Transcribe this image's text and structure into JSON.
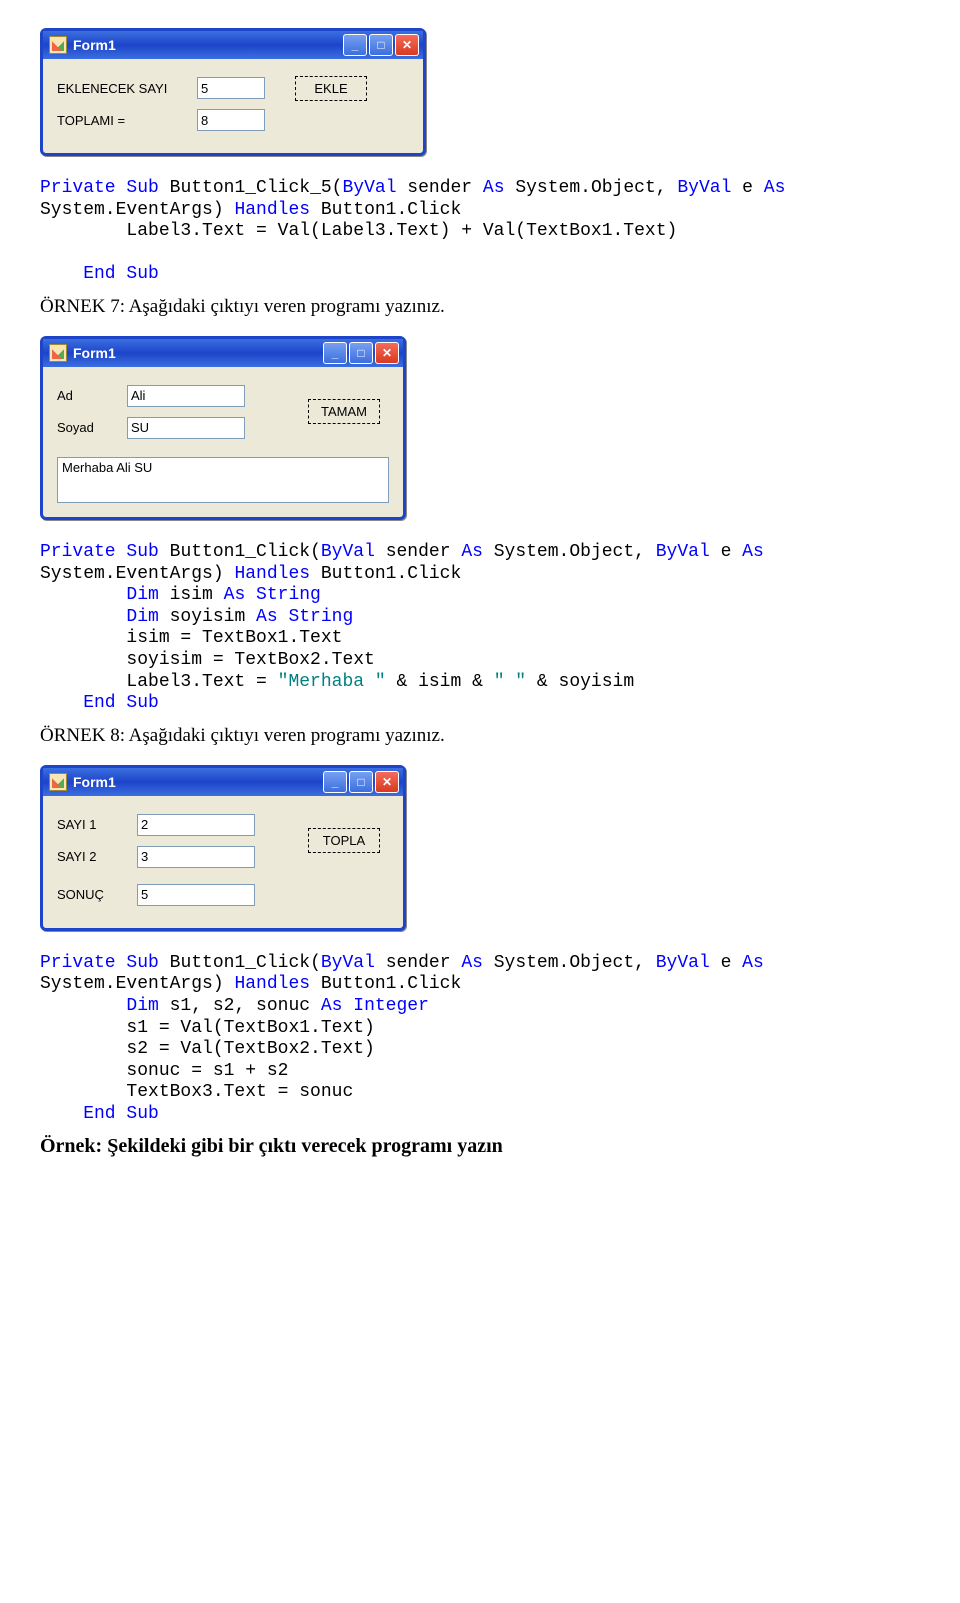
{
  "form1": {
    "title": "Form1",
    "label_eklenecek": "EKLENECEK SAYI",
    "label_toplam": "TOPLAMI =",
    "input_sayi": "5",
    "input_toplam": "8",
    "btn_ekle": "EKLE"
  },
  "code1": {
    "l1a": "Private",
    "l1b": " Sub",
    "l1c": " Button1_Click_5(",
    "l1d": "ByVal",
    "l1e": " sender ",
    "l1f": "As",
    "l1g": " System.Object, ",
    "l1h": "ByVal",
    "l1i": " e ",
    "l1j": "As",
    "l2a": "System.EventArgs) ",
    "l2b": "Handles",
    "l2c": " Button1.Click",
    "l3": "        Label3.Text = Val(Label3.Text) + Val(TextBox1.Text)",
    "l5a": "    End",
    "l5b": " Sub"
  },
  "p7": "ÖRNEK 7: Aşağıdaki çıktıyı veren programı yazınız.",
  "form2": {
    "title": "Form1",
    "label_ad": "Ad",
    "label_soyad": "Soyad",
    "input_ad": "Ali",
    "input_soyad": "SU",
    "btn_tamam": "TAMAM",
    "memo": "Merhaba Ali SU"
  },
  "code2": {
    "l1a": "Private",
    "l1b": " Sub",
    "l1c": " Button1_Click(",
    "l1d": "ByVal",
    "l1e": " sender ",
    "l1f": "As",
    "l1g": " System.Object, ",
    "l1h": "ByVal",
    "l1i": " e ",
    "l1j": "As",
    "l2a": "System.EventArgs) ",
    "l2b": "Handles",
    "l2c": " Button1.Click",
    "l3a": "        Dim",
    "l3b": " isim ",
    "l3c": "As",
    "l3d": " String",
    "l4a": "        Dim",
    "l4b": " soyisim ",
    "l4c": "As",
    "l4d": " String",
    "l5": "        isim = TextBox1.Text",
    "l6": "        soyisim = TextBox2.Text",
    "l7a": "        Label3.Text = ",
    "l7b": "\"Merhaba \"",
    "l7c": " & isim & ",
    "l7d": "\" \"",
    "l7e": " & soyisim",
    "l8a": "    End",
    "l8b": " Sub"
  },
  "p8": "ÖRNEK 8: Aşağıdaki çıktıyı veren programı yazınız.",
  "form3": {
    "title": "Form1",
    "label_s1": "SAYI 1",
    "label_s2": "SAYI 2",
    "label_sonuc": "SONUÇ",
    "input_s1": "2",
    "input_s2": "3",
    "input_sonuc": "5",
    "btn_topla": "TOPLA"
  },
  "code3": {
    "l1a": "Private",
    "l1b": " Sub",
    "l1c": " Button1_Click(",
    "l1d": "ByVal",
    "l1e": " sender ",
    "l1f": "As",
    "l1g": " System.Object, ",
    "l1h": "ByVal",
    "l1i": " e ",
    "l1j": "As",
    "l2a": "System.EventArgs) ",
    "l2b": "Handles",
    "l2c": " Button1.Click",
    "l3a": "        Dim",
    "l3b": " s1, s2, sonuc ",
    "l3c": "As",
    "l3d": " Integer",
    "l4": "        s1 = Val(TextBox1.Text)",
    "l5": "        s2 = Val(TextBox2.Text)",
    "l6": "        sonuc = s1 + s2",
    "l7": "        TextBox3.Text = sonuc",
    "l8a": "    End",
    "l8b": " Sub"
  },
  "pLast": "Örnek: Şekildeki gibi bir çıktı verecek programı yazın"
}
